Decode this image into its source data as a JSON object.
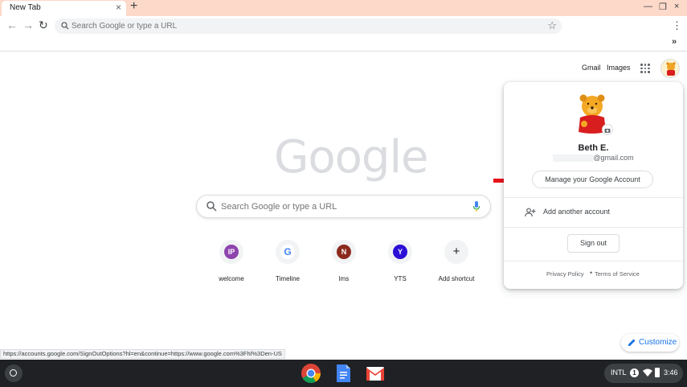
{
  "tab": {
    "title": "New Tab",
    "close": "×",
    "new_tab": "+"
  },
  "window_controls": {
    "minimize": "—",
    "maximize": "❐",
    "close": "×"
  },
  "toolbar": {
    "back": "←",
    "forward": "→",
    "reload": "↻",
    "omnibox_placeholder": "Search Google or type a URL",
    "bookmark_star": "☆",
    "menu": "⋮",
    "bookmarks_more": "»"
  },
  "top_links": {
    "gmail": "Gmail",
    "images": "Images"
  },
  "logo": "Google",
  "search": {
    "placeholder": "Search Google or type a URL"
  },
  "shortcuts": [
    {
      "label": "welcome",
      "initial": "IP",
      "color": "#8e44ad"
    },
    {
      "label": "Timeline",
      "initial": "G",
      "color": "#ffffff"
    },
    {
      "label": "lms",
      "initial": "N",
      "color": "#8b2a1d"
    },
    {
      "label": "YTS",
      "initial": "Y",
      "color": "#2c0fd6"
    },
    {
      "label": "Add shortcut",
      "initial": "+",
      "color": "#f1f3f4"
    }
  ],
  "account_popup": {
    "name": "Beth E.",
    "email_suffix": "@gmail.com",
    "manage_button": "Manage your Google Account",
    "add_account": "Add another account",
    "sign_out": "Sign out",
    "privacy_policy": "Privacy Policy",
    "separator": "•",
    "terms": "Terms of Service"
  },
  "status_url": "https://accounts.google.com/SignOutOptions?hl=en&continue=https://www.google.com%3Fhl%3Den-US",
  "customize": "Customize",
  "tray": {
    "input_method": "INTL",
    "notification_count": "1",
    "time": "3:46"
  },
  "colors": {
    "accent": "#1a73e8",
    "tabstrip": "#fcd9c9",
    "shelf": "#202124",
    "arrow": "#e8121b"
  }
}
